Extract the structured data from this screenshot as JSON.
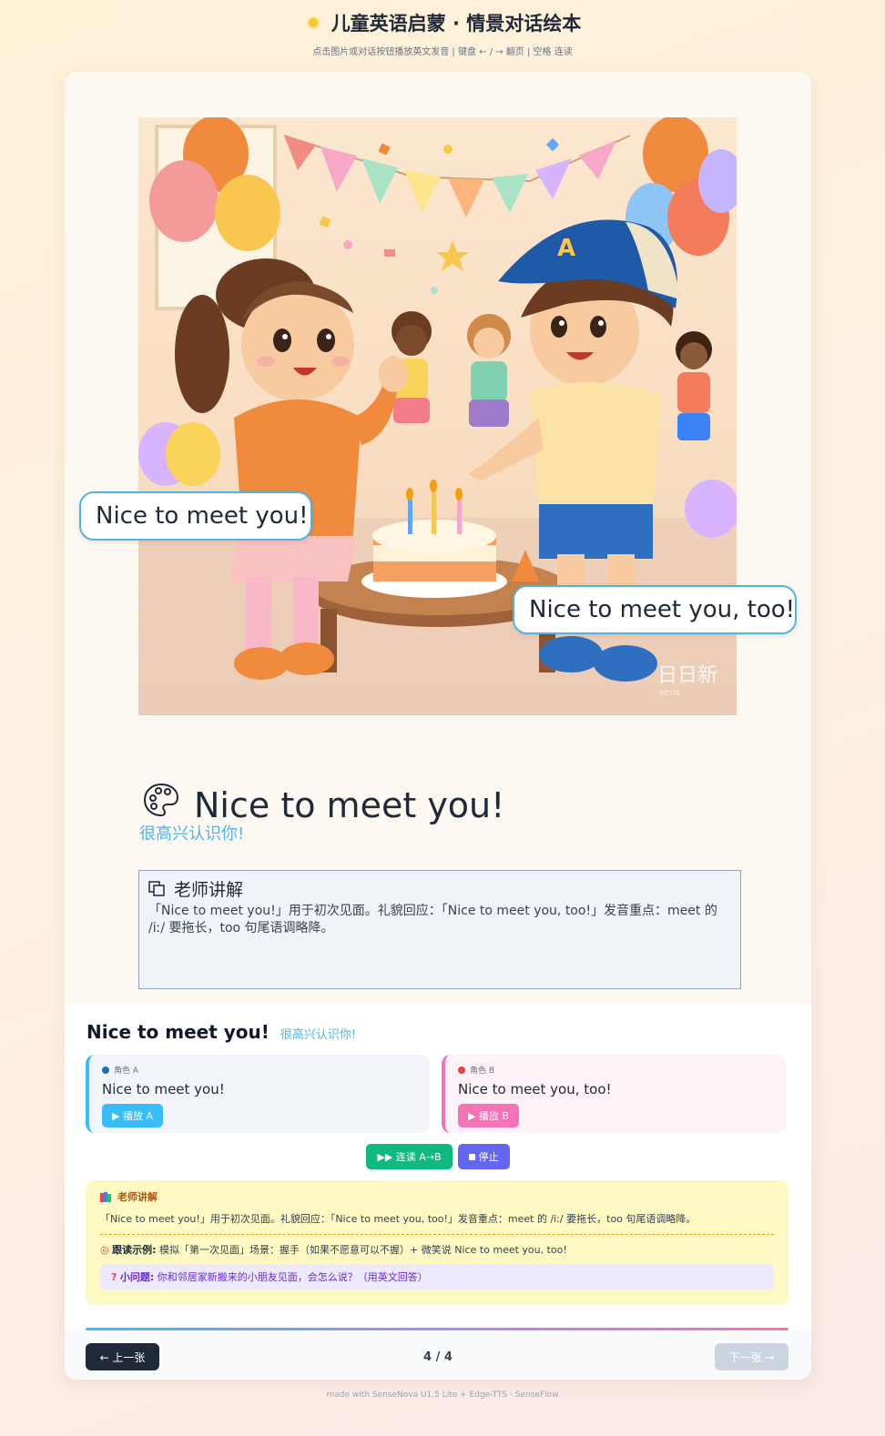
{
  "header": {
    "title": "儿童英语启蒙 · 情景对话绘本",
    "hint": "点击图片或对话按钮播放英文发音 | 键盘 ← / → 翻页 | 空格 连读"
  },
  "slide": {
    "bubble_a": "Nice to meet you!",
    "bubble_b": "Nice to meet you, too!",
    "watermark": "日日新",
    "sentence_en": "Nice to meet you!",
    "sentence_zh": "很高兴认识你!",
    "teacher_title": "老师讲解",
    "teacher_text": "「Nice to meet you!」用于初次见面。礼貌回应：「Nice to meet you, too!」发音重点：meet 的 /iː/ 要拖长，too 句尾语调略降。"
  },
  "panel": {
    "title_en": "Nice to meet you!",
    "title_zh": "很高兴认识你!",
    "role_a": {
      "tag": "角色 A",
      "text": "Nice to meet you!",
      "button": "▶ 播放 A",
      "color": "#38bdf8"
    },
    "role_b": {
      "tag": "角色 B",
      "text": "Nice to meet you, too!",
      "button": "▶ 播放 B",
      "color": "#f472b6"
    },
    "btn_chain": "▶▶ 连读 A→B",
    "btn_stop": "停止",
    "notes": {
      "title": "老师讲解",
      "text": "「Nice to meet you!」用于初次见面。礼貌回应：「Nice to meet you, too!」发音重点：meet 的 /iː/ 要拖长，too 句尾语调略降。",
      "follow_label": "跟读示例:",
      "follow_text": "模拟「第一次见面」场景：握手（如果不愿意可以不握）+ 微笑说 Nice to meet you, too!",
      "question_label": "小问题:",
      "question_text": "你和邻居家新搬来的小朋友见面，会怎么说？（用英文回答）"
    }
  },
  "nav": {
    "prev": "← 上一张",
    "page": "4 / 4",
    "next": "下一张 →"
  },
  "footer": "made with SenseNova U1.5 Lite + Edge-TTS · SenseFlow"
}
